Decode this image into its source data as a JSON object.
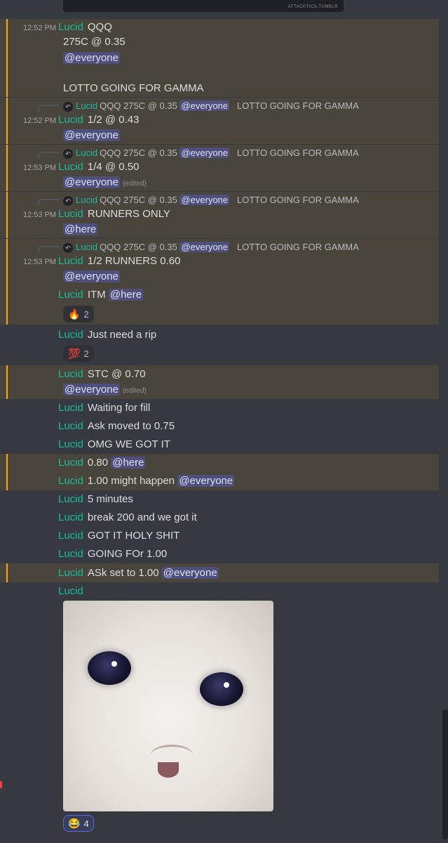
{
  "top_image": {
    "caption": "ATTACKTICS.TUMBLR"
  },
  "messages": {
    "m1": {
      "time": "12:52 PM",
      "author": "Lucid",
      "l1": "QQQ",
      "l2": "275C @ 0.35",
      "mention": "@everyone",
      "l4": "LOTTO GOING FOR GAMMA"
    },
    "m2": {
      "time": "12:52 PM",
      "author": "Lucid",
      "text": "1/2 @ 0.43",
      "mention": "@everyone"
    },
    "m3": {
      "time": "12:53 PM",
      "author": "Lucid",
      "text": "1/4 @ 0.50",
      "mention": "@everyone",
      "edited": "(edited)"
    },
    "m4": {
      "time": "12:53 PM",
      "author": "Lucid",
      "text": "RUNNERS ONLY",
      "mention": "@here"
    },
    "m5": {
      "time": "12:53 PM",
      "author": "Lucid",
      "text": "1/2 RUNNERS 0.60",
      "mention": "@everyone"
    },
    "m6": {
      "author": "Lucid",
      "text": "ITM",
      "mention": "@here",
      "reaction": {
        "emoji": "🔥",
        "count": "2"
      }
    },
    "m7": {
      "author": "Lucid",
      "text": "Just need a rip",
      "reaction": {
        "emoji": "💯",
        "count": "2"
      }
    },
    "m8": {
      "author": "Lucid",
      "text": "STC @ 0.70",
      "mention": "@everyone",
      "edited": "(edited)"
    },
    "m9": {
      "author": "Lucid",
      "text": "Waiting for fill"
    },
    "m10": {
      "author": "Lucid",
      "text": "Ask moved to 0.75"
    },
    "m11": {
      "author": "Lucid",
      "text": "OMG WE GOT IT"
    },
    "m12": {
      "author": "Lucid",
      "text": "0.80",
      "mention": "@here"
    },
    "m13": {
      "author": "Lucid",
      "text": "1.00 might happen",
      "mention": "@everyone"
    },
    "m14": {
      "author": "Lucid",
      "text": "5 minutes"
    },
    "m15": {
      "author": "Lucid",
      "text": "break 200 and we got it"
    },
    "m16": {
      "author": "Lucid",
      "text": "GOT IT HOLY SHIT"
    },
    "m17": {
      "author": "Lucid",
      "text": "GOING FOr 1.00"
    },
    "m18": {
      "author": "Lucid",
      "text": "ASk set to 1.00",
      "mention": "@everyone"
    },
    "m19": {
      "author": "Lucid",
      "reaction": {
        "emoji": "😂",
        "count": "4"
      }
    }
  },
  "reply": {
    "author": "Lucid",
    "text": "QQQ 275C @ 0.35",
    "mention": "@everyone",
    "trail": "LOTTO GOING FOR GAMMA"
  },
  "colors": {
    "author": "#1abc9c",
    "mention_bg": "#49443c",
    "mention_bar": "#faa81a",
    "background": "#36393f"
  }
}
